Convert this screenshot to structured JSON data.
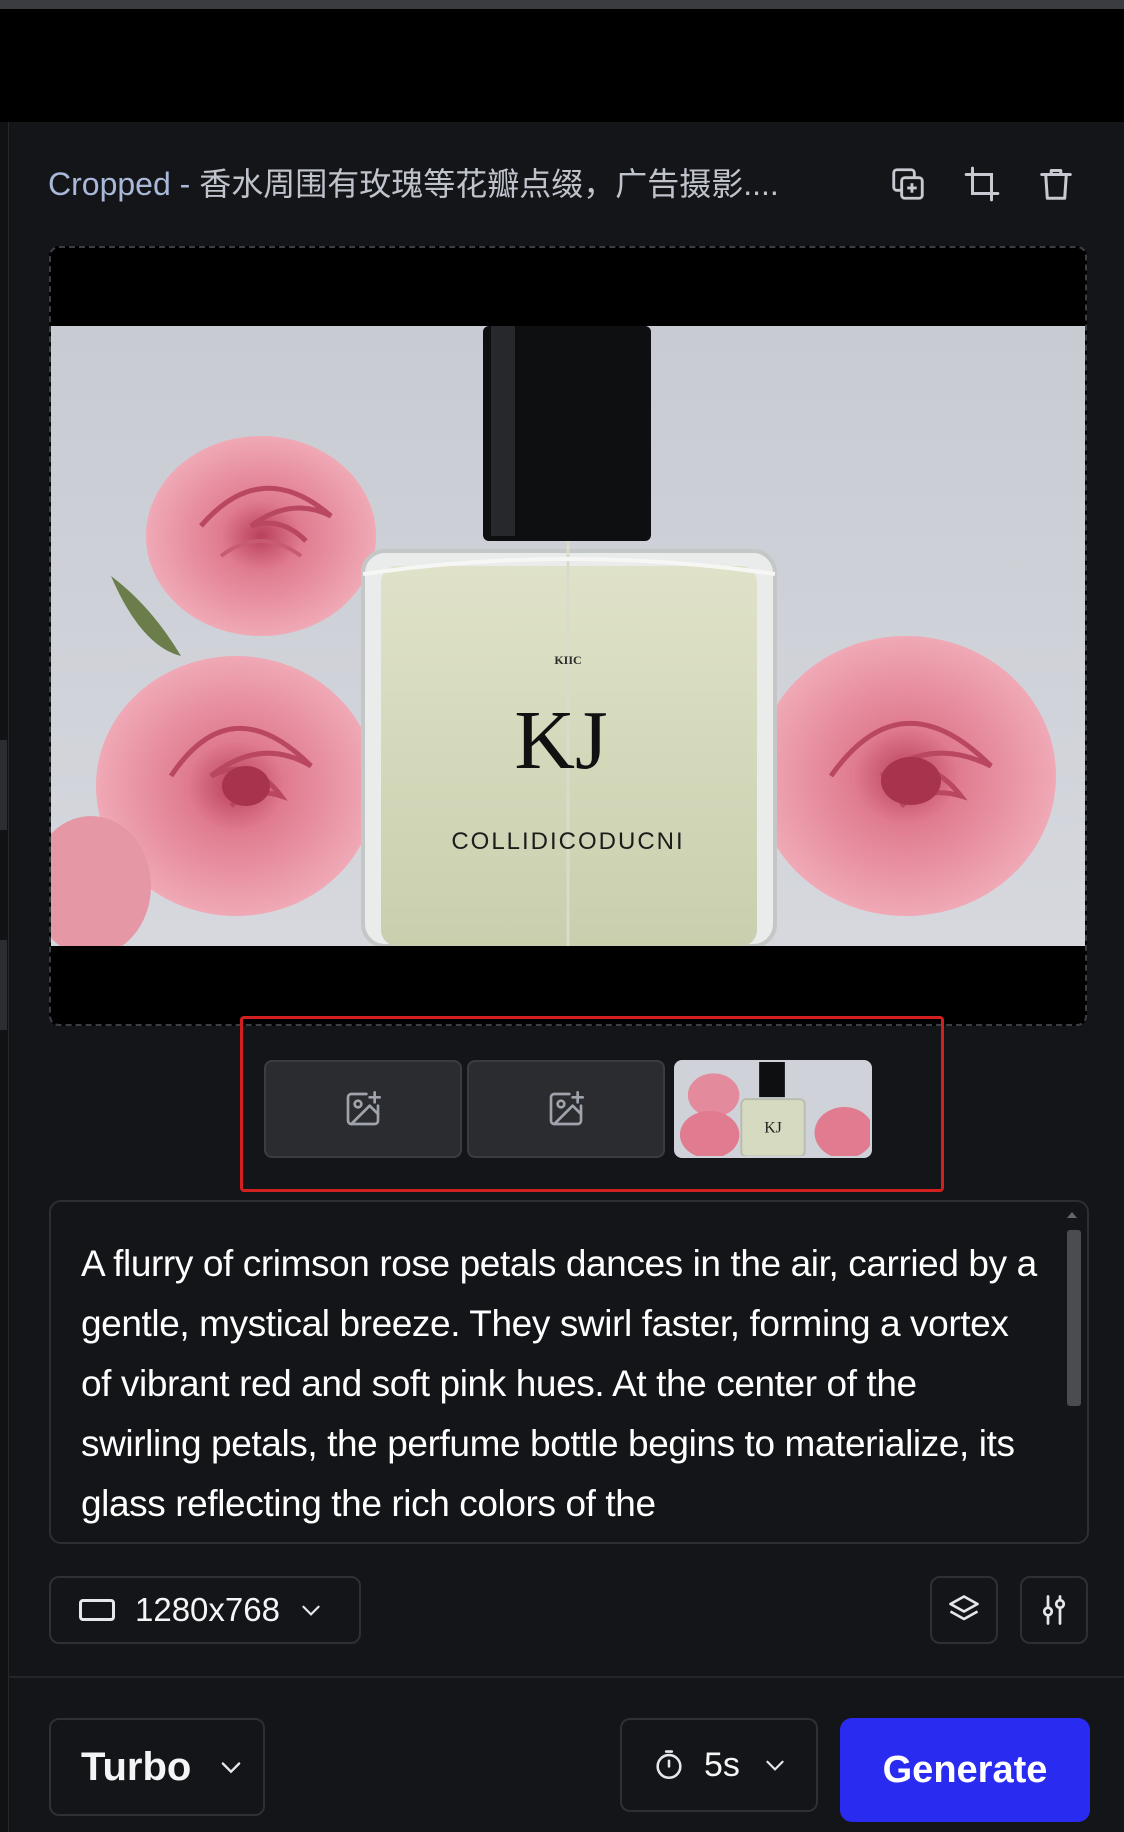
{
  "header": {
    "title_prefix": "Cropped - ",
    "title_rest": "香水周围有玫瑰等花瓣点缀，广告摄影....",
    "icons": [
      "duplicate-icon",
      "crop-icon",
      "trash-icon"
    ]
  },
  "preview": {
    "bottle_small_label": "KIIC",
    "bottle_brand": "KJ",
    "bottle_name": "COLLIDICODUCNI",
    "thumb_brand": "KJ"
  },
  "thumbnails": {
    "empty_slot_icon": "image-plus-icon",
    "selected_index": 2
  },
  "prompt": {
    "text": "A flurry of crimson rose petals dances in the air, carried by a gentle, mystical breeze. They swirl faster, forming a vortex of vibrant red and soft pink hues. At the center of the swirling petals, the perfume bottle begins to materialize, its glass reflecting the rich colors of the"
  },
  "controls": {
    "resolution": "1280x768",
    "layers_icon": "layers-icon",
    "settings_icon": "sliders-icon"
  },
  "footer": {
    "model": "Turbo",
    "duration": "5s",
    "generate_label": "Generate"
  },
  "colors": {
    "accent": "#2a2bf0",
    "highlight_border": "#d21f1f",
    "background": "#141518"
  }
}
